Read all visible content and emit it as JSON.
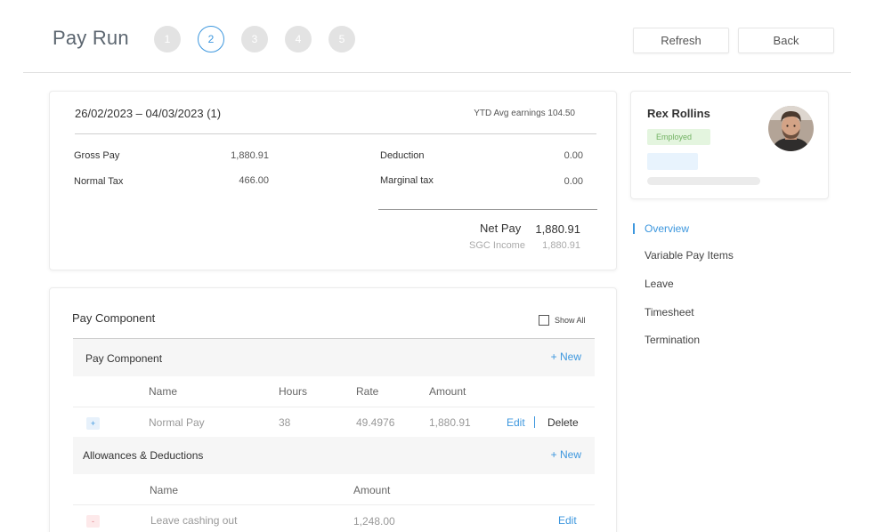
{
  "header": {
    "title": "Pay Run",
    "steps": [
      "1",
      "2",
      "3",
      "4",
      "5"
    ],
    "active_step": 2,
    "refresh_label": "Refresh",
    "back_label": "Back"
  },
  "summary": {
    "period": "26/02/2023 – 04/03/2023 (1)",
    "ytd": "YTD Avg earnings 104.50",
    "gross_pay_label": "Gross Pay",
    "gross_pay": "1,880.91",
    "normal_tax_label": "Normal Tax",
    "normal_tax": "466.00",
    "deduction_label": "Deduction",
    "deduction": "0.00",
    "marginal_tax_label": "Marginal tax",
    "marginal_tax": "0.00",
    "net_pay_label": "Net Pay",
    "net_pay": "1,880.91",
    "sgc_label": "SGC Income",
    "sgc": "1,880.91"
  },
  "components": {
    "title": "Pay Component",
    "show_all_label": "Show All",
    "show_all_checked": false,
    "pay_section": {
      "title": "Pay Component",
      "new_label": "+ New",
      "columns": [
        "Name",
        "Hours",
        "Rate",
        "Amount"
      ],
      "rows": [
        {
          "name": "Normal Pay",
          "hours": "38",
          "rate": "49.4976",
          "amount": "1,880.91",
          "edit": "Edit",
          "delete": "Delete"
        }
      ]
    },
    "allow_section": {
      "title": "Allowances & Deductions",
      "new_label": "+ New",
      "columns": [
        "Name",
        "Amount"
      ],
      "rows": [
        {
          "name": "Leave cashing out",
          "amount": "1,248.00",
          "edit": "Edit"
        }
      ]
    }
  },
  "employee": {
    "name": "Rex Rollins",
    "status": "Employed"
  },
  "nav": {
    "items": [
      "Overview",
      "Variable Pay Items",
      "Leave",
      "Timesheet",
      "Termination"
    ],
    "active": "Overview"
  },
  "colors": {
    "accent": "#3d97de",
    "employed_bg": "#e4f5df",
    "employed_text": "#72b263"
  }
}
